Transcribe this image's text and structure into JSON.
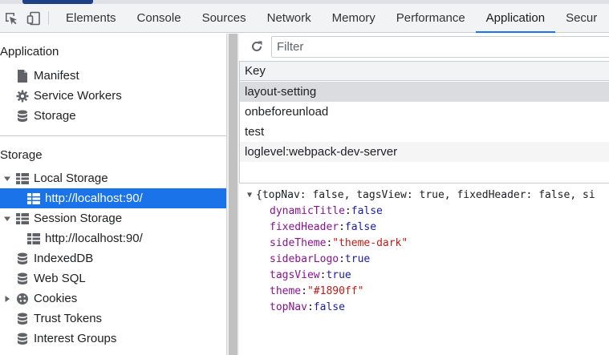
{
  "toolbar": {
    "tabs": [
      {
        "label": "Elements"
      },
      {
        "label": "Console"
      },
      {
        "label": "Sources"
      },
      {
        "label": "Network"
      },
      {
        "label": "Memory"
      },
      {
        "label": "Performance"
      },
      {
        "label": "Application",
        "active": true
      },
      {
        "label": "Secur"
      }
    ],
    "accent_color": "#1a73e8"
  },
  "sidebar": {
    "application_title": "Application",
    "application_items": [
      {
        "label": "Manifest",
        "icon": "file-icon"
      },
      {
        "label": "Service Workers",
        "icon": "gear-icon"
      },
      {
        "label": "Storage",
        "icon": "database-icon"
      }
    ],
    "storage_title": "Storage",
    "local_storage": {
      "label": "Local Storage",
      "expanded": true,
      "child": "http://localhost:90/"
    },
    "session_storage": {
      "label": "Session Storage",
      "expanded": true,
      "child": "http://localhost:90/"
    },
    "indexeddb": "IndexedDB",
    "websql": "Web SQL",
    "cookies": "Cookies",
    "trust_tokens": "Trust Tokens",
    "interest_groups": "Interest Groups"
  },
  "main": {
    "filter_placeholder": "Filter",
    "column_key": "Key",
    "rows": [
      {
        "key": "layout-setting",
        "selected": true
      },
      {
        "key": "onbeforeunload"
      },
      {
        "key": "test"
      },
      {
        "key": "loglevel:webpack-dev-server"
      }
    ],
    "preview": {
      "summary": "{topNav: false, tagsView: true, fixedHeader: false, si",
      "props": [
        {
          "key": "dynamicTitle",
          "value": "false",
          "type": "bool"
        },
        {
          "key": "fixedHeader",
          "value": "false",
          "type": "bool"
        },
        {
          "key": "sideTheme",
          "value": "\"theme-dark\"",
          "type": "str"
        },
        {
          "key": "sidebarLogo",
          "value": "true",
          "type": "bool"
        },
        {
          "key": "tagsView",
          "value": "true",
          "type": "bool"
        },
        {
          "key": "theme",
          "value": "\"#1890ff\"",
          "type": "str"
        },
        {
          "key": "topNav",
          "value": "false",
          "type": "bool"
        }
      ]
    }
  }
}
